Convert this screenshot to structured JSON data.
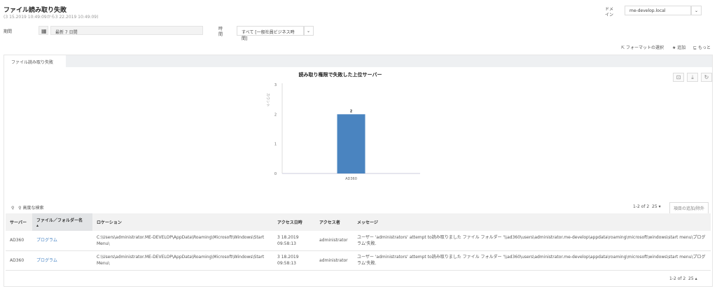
{
  "header": {
    "title": "ファイル読み取り失敗",
    "subtitle": "(3 15.2019 10:49:09から3 22.2019 10:49:09)"
  },
  "filters": {
    "period_label": "期間",
    "period_value": "最新 7 日間",
    "time_label": "時\n間",
    "time_value": "すべて [一般社員ビジネス時間]",
    "domain_label": "ドメ\nイン",
    "domain_value": "me-develop.local"
  },
  "actions": {
    "format": "フォーマットの選択",
    "add": "追加",
    "more": "もっと"
  },
  "tab": "ファイル読み取り失敗",
  "chart_data": {
    "type": "bar",
    "title": "読み取り権限で失敗した上位サーバー",
    "categories": [
      "AD360"
    ],
    "values": [
      2
    ],
    "ylabel": "カウント",
    "xlabel": "",
    "ylim": [
      0,
      3
    ],
    "yticks": [
      "0",
      "1",
      "2",
      "3"
    ],
    "data_labels": [
      "2"
    ],
    "color": "#4a84c0"
  },
  "table": {
    "search_label": "高度な検索",
    "pagination": "1-2 of 2",
    "page_size": "25",
    "add_remove": "項目の追加/除外",
    "columns": [
      "サーバー",
      "ファイル／フォルダー名",
      "ロケーション",
      "アクセス日時",
      "アクセス者",
      "メッセージ"
    ],
    "rows": [
      {
        "server": "AD360",
        "name": "プログラム",
        "location": "C:\\Users\\administrator.ME-DEVELOP\\AppData\\Roaming\\Microsoft\\Windows\\Start Menu\\",
        "time": "3 18.2019 09:58:13",
        "user": "administrator",
        "message": "ユーザー 'administrators' attempt to読み取りました ファイル フォルダー '\\\\ad360\\users\\administrator.me-develop\\appdata\\roaming\\microsoft\\windows\\start menu\\プログラム'失敗."
      },
      {
        "server": "AD360",
        "name": "プログラム",
        "location": "C:\\Users\\administrator.ME-DEVELOP\\AppData\\Roaming\\Microsoft\\Windows\\Start Menu\\",
        "time": "3 18.2019 09:58:13",
        "user": "administrator",
        "message": "ユーザー 'administrators' attempt to読み取りました ファイル フォルダー '\\\\ad360\\users\\administrator.me-develop\\appdata\\roaming\\microsoft\\windows\\start menu\\プログラム'失敗."
      }
    ]
  }
}
